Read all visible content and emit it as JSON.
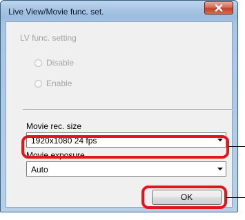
{
  "window": {
    "title": "Live View/Movie func. set."
  },
  "icons": {
    "close": "close-icon"
  },
  "lv_func": {
    "group_label": "LV func. setting",
    "options": [
      {
        "label": "Disable",
        "selected": false,
        "enabled": false
      },
      {
        "label": "Enable",
        "selected": false,
        "enabled": false
      }
    ]
  },
  "movie_rec_size": {
    "label": "Movie rec. size",
    "value": "1920x1080  24 fps"
  },
  "movie_exposure": {
    "label": "Movie exposure",
    "value": "Auto"
  },
  "buttons": {
    "ok_label": "OK"
  },
  "colors": {
    "highlight": "#e5141b",
    "title_bar": "#a9c6e4",
    "close_button": "#c2412a"
  }
}
